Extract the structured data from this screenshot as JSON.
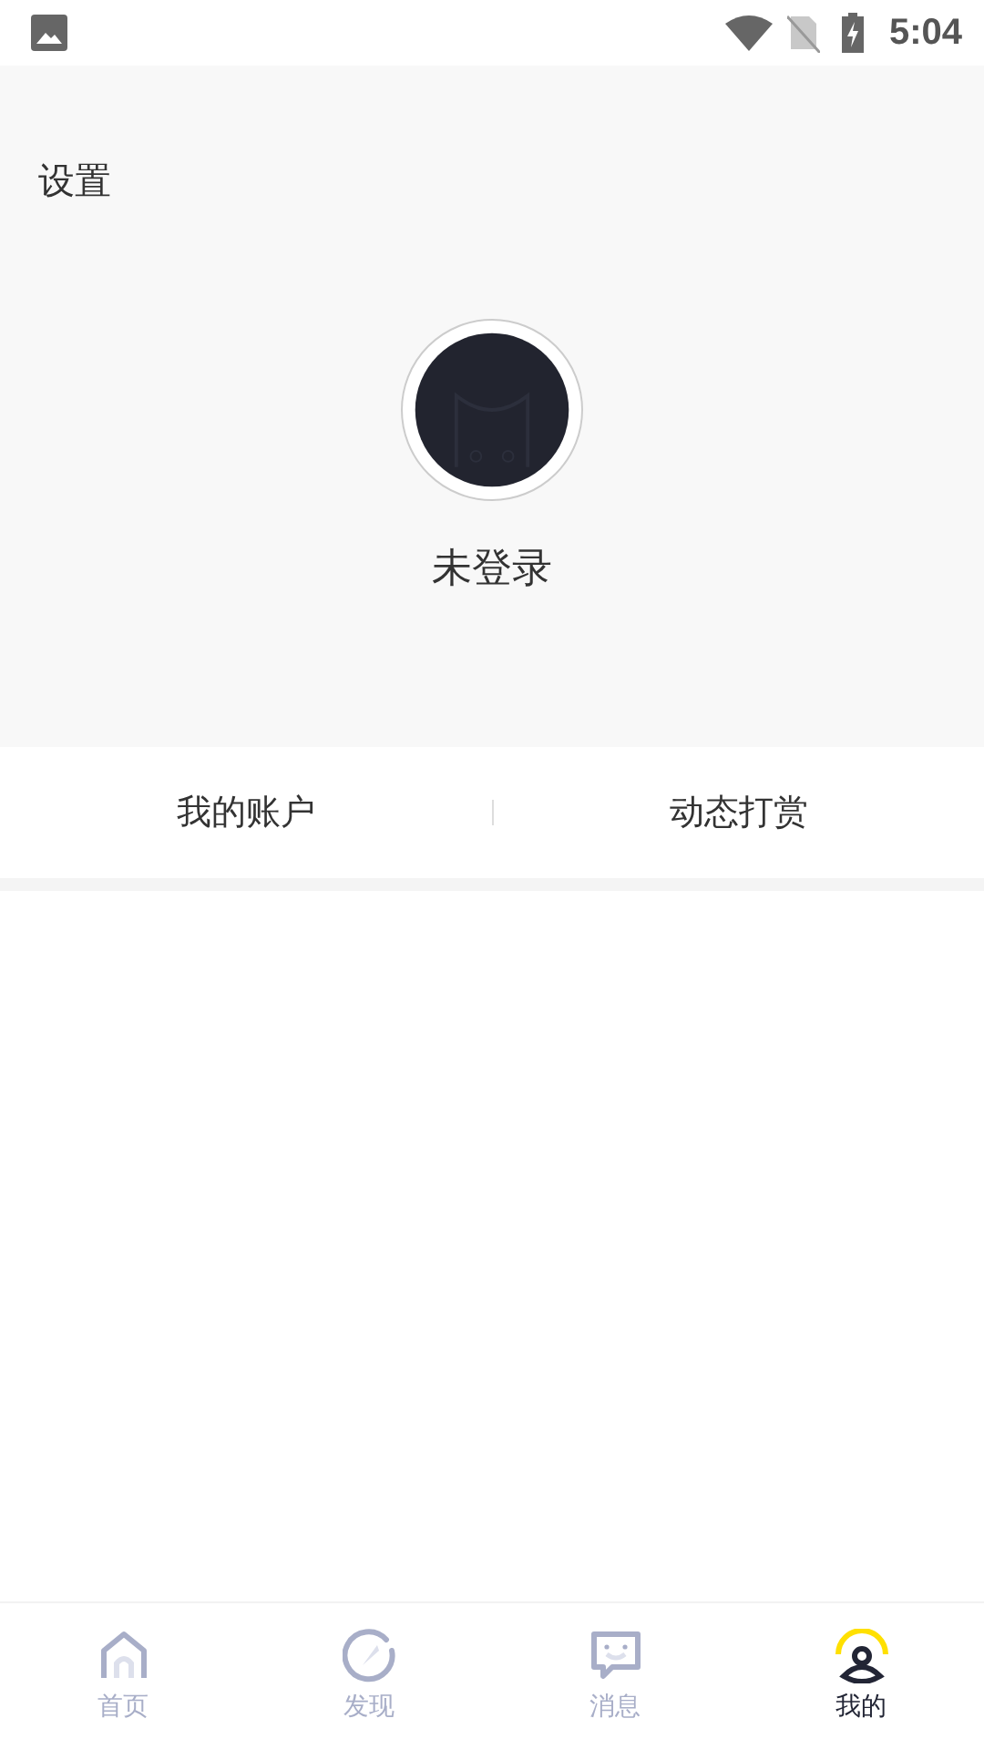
{
  "status_bar": {
    "time": "5:04"
  },
  "header": {
    "title": "设置",
    "login_status": "未登录"
  },
  "account_tabs": [
    {
      "label": "我的账户"
    },
    {
      "label": "动态打赏"
    }
  ],
  "bottom_nav": [
    {
      "kind": "home",
      "label": "首页",
      "selected": false
    },
    {
      "kind": "discover",
      "label": "发现",
      "selected": false
    },
    {
      "kind": "messages",
      "label": "消息",
      "selected": false
    },
    {
      "kind": "profile",
      "label": "我的",
      "selected": true
    }
  ]
}
